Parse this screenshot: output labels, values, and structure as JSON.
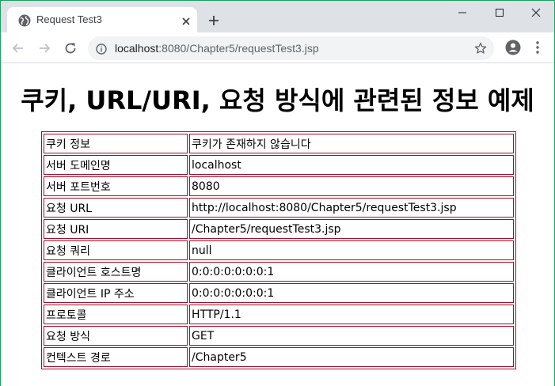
{
  "browser": {
    "tab_title": "Request Test3",
    "url_host": "localhost",
    "url_rest": ":8080/Chapter5/requestTest3.jsp",
    "accent_border": "#1aa260"
  },
  "page": {
    "title": "쿠키, URL/URI, 요청 방식에 관련된 정보 예제",
    "table_border_color": "#a0102a",
    "rows": [
      {
        "key": "쿠키 정보",
        "value": "쿠키가 존재하지 않습니다"
      },
      {
        "key": "서버 도메인명",
        "value": "localhost"
      },
      {
        "key": "서버 포트번호",
        "value": "8080"
      },
      {
        "key": "요청 URL",
        "value": "http://localhost:8080/Chapter5/requestTest3.jsp"
      },
      {
        "key": "요청 URI",
        "value": "/Chapter5/requestTest3.jsp"
      },
      {
        "key": "요청 쿼리",
        "value": "null"
      },
      {
        "key": "클라이언트 호스트명",
        "value": "0:0:0:0:0:0:0:1"
      },
      {
        "key": "클라이언트 IP 주소",
        "value": "0:0:0:0:0:0:0:1"
      },
      {
        "key": "프로토콜",
        "value": "HTTP/1.1"
      },
      {
        "key": "요청 방식",
        "value": "GET"
      },
      {
        "key": "컨텍스트 경로",
        "value": "/Chapter5"
      }
    ]
  },
  "icons": {
    "favicon": "globe-icon",
    "tab_close": "close-icon",
    "new_tab": "plus-icon",
    "minimize": "minimize-icon",
    "maximize": "maximize-icon",
    "close_window": "close-window-icon",
    "back": "back-arrow-icon",
    "forward": "forward-arrow-icon",
    "reload": "reload-icon",
    "site_info": "info-icon",
    "bookmark": "star-icon",
    "profile": "account-icon",
    "menu": "kebab-menu-icon"
  }
}
